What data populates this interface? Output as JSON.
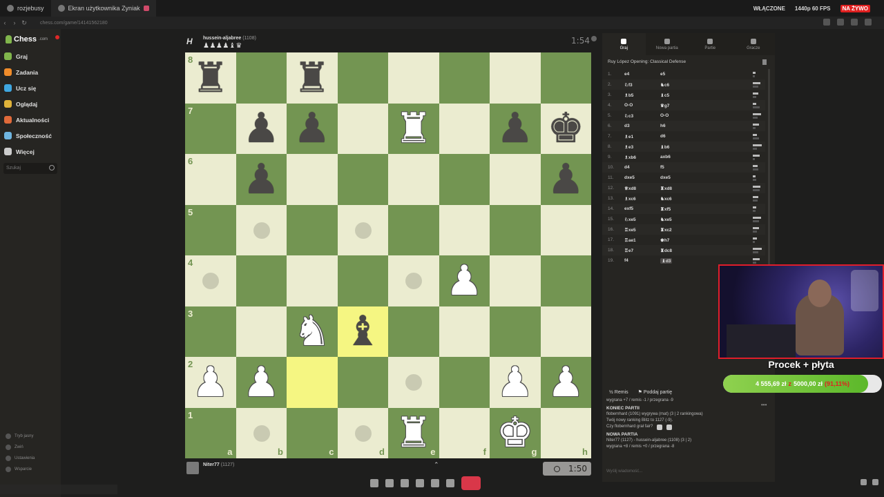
{
  "browser": {
    "tabs": [
      {
        "label": "rozjebusy",
        "active": false
      },
      {
        "label": "Ekran użytkownika Zyniak",
        "active": true
      }
    ],
    "status": {
      "broadcast": "WŁĄCZONE",
      "quality": "1440p 60 FPS",
      "live": "NA ŻYWO"
    },
    "url": "chess.com/game/14141562180"
  },
  "sidebar": {
    "logo": "Chess",
    "logo_suffix": ".com",
    "items": [
      {
        "label": "Graj",
        "icon": "play-icon",
        "color": "#81b64c"
      },
      {
        "label": "Zadania",
        "icon": "puzzle-icon",
        "color": "#f08c2a"
      },
      {
        "label": "Ucz się",
        "icon": "learn-icon",
        "color": "#3fa7e0"
      },
      {
        "label": "Oglądaj",
        "icon": "watch-icon",
        "color": "#e0b33a"
      },
      {
        "label": "Aktualności",
        "icon": "news-icon",
        "color": "#e06a3a"
      },
      {
        "label": "Społeczność",
        "icon": "community-icon",
        "color": "#6fb5e0"
      },
      {
        "label": "Więcej",
        "icon": "more-icon",
        "color": "#cccccc"
      }
    ],
    "search_placeholder": "Szukaj",
    "bottom_items": [
      "Tryb jasny",
      "Zwiń",
      "Ustawienia",
      "Wsparcie"
    ]
  },
  "opponent": {
    "name": "hussein-aljabree",
    "rating": "(1108)",
    "captured": "♟♟♟♟♝♛",
    "clock": "1:54"
  },
  "player": {
    "name": "Niter77",
    "rating": "(1127)",
    "clock": "1:50"
  },
  "board": {
    "files": [
      "a",
      "b",
      "c",
      "d",
      "e",
      "f",
      "g",
      "h"
    ],
    "ranks": [
      "8",
      "7",
      "6",
      "5",
      "4",
      "3",
      "2",
      "1"
    ],
    "pieces": {
      "a8": "br",
      "c8": "br",
      "b7": "bp",
      "c7": "bp",
      "e7": "wr",
      "g7": "bp",
      "h7": "bk",
      "b6": "bp",
      "h6": "bp",
      "f4": "wp",
      "c3": "wn",
      "d3": "bb",
      "a2": "wp",
      "b2": "wp",
      "g2": "wp",
      "h2": "wp",
      "e1": "wr",
      "g1": "wk"
    },
    "highlight": [
      "c2",
      "d3"
    ],
    "hints": [
      "b5",
      "d5",
      "a4",
      "e4",
      "e2",
      "b1",
      "d1"
    ]
  },
  "panel": {
    "tabs": [
      {
        "label": "Graj",
        "icon": "lightning-icon",
        "active": true
      },
      {
        "label": "Nowa partia",
        "icon": "plus-icon",
        "active": false
      },
      {
        "label": "Partie",
        "icon": "grid-icon",
        "active": false
      },
      {
        "label": "Gracze",
        "icon": "players-icon",
        "active": false
      }
    ],
    "opening": "Ruy López Opening: Classical Defense",
    "moves": [
      {
        "n": "1.",
        "w": "e4",
        "b": "e5"
      },
      {
        "n": "2.",
        "w": "♘f3",
        "b": "♞c6"
      },
      {
        "n": "3.",
        "w": "♗b5",
        "b": "♝c5"
      },
      {
        "n": "4.",
        "w": "O-O",
        "b": "♛g7"
      },
      {
        "n": "5.",
        "w": "♘c3",
        "b": "O-O"
      },
      {
        "n": "6.",
        "w": "d3",
        "b": "h6"
      },
      {
        "n": "7.",
        "w": "♗e1",
        "b": "d6"
      },
      {
        "n": "8.",
        "w": "♗e3",
        "b": "♝b6"
      },
      {
        "n": "9.",
        "w": "♗xb6",
        "b": "axb6"
      },
      {
        "n": "10.",
        "w": "d4",
        "b": "f5"
      },
      {
        "n": "11.",
        "w": "dxe5",
        "b": "dxe5"
      },
      {
        "n": "12.",
        "w": "♕xd8",
        "b": "♜xd8"
      },
      {
        "n": "13.",
        "w": "♗xc6",
        "b": "♞xc6"
      },
      {
        "n": "14.",
        "w": "exf5",
        "b": "♜xf5"
      },
      {
        "n": "15.",
        "w": "♘xe5",
        "b": "♞xe5"
      },
      {
        "n": "16.",
        "w": "♖xe5",
        "b": "♜xc2"
      },
      {
        "n": "17.",
        "w": "♖ae1",
        "b": "♚h7"
      },
      {
        "n": "18.",
        "w": "♖e7",
        "b": "♜dc8"
      },
      {
        "n": "19.",
        "w": "f4",
        "b": "♝d3"
      }
    ],
    "actions": {
      "draw": "Remis",
      "resign": "Poddaj partię"
    },
    "chat": [
      {
        "type": "line",
        "text": "wygrana +7 / remis -1 / przegrana -9"
      },
      {
        "type": "head",
        "text": "KONIEC PARTII"
      },
      {
        "type": "line",
        "text": "flobernhard (1091) wygrywa (mat) (3 | 2 rankingowa)"
      },
      {
        "type": "line",
        "text": "Twój nowy ranking Blitz to 1127 (-9)."
      },
      {
        "type": "vote",
        "text": "Czy flobernhard grał fair?"
      },
      {
        "type": "head",
        "text": "NOWA PARTIA"
      },
      {
        "type": "line",
        "text": "Niter77 (1127) - hussein-aljabree (1108) (3 | 2)"
      },
      {
        "type": "line",
        "text": "wygrana +8 / remis +0 / przegrana -8"
      }
    ],
    "chat_placeholder": "Wyślij wiadomość..."
  },
  "donation": {
    "title": "Procek + płyta",
    "current": "4 555,69 zł",
    "separator": "z",
    "goal": "5000,00 zł",
    "percent": "(91,11%)",
    "progress": 0.9111
  }
}
